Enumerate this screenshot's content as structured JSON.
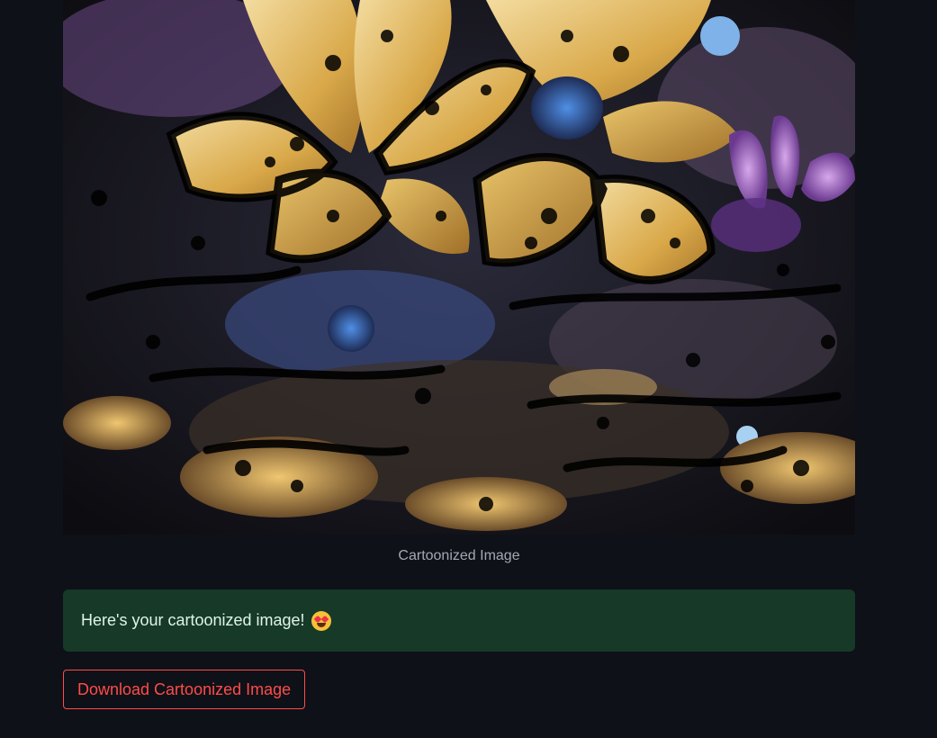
{
  "image": {
    "alt": "Cartoonized flower image",
    "caption": "Cartoonized Image"
  },
  "alert": {
    "message": "Here's your cartoonized image!",
    "emoji_icon": "star-struck-icon"
  },
  "download": {
    "label": "Download Cartoonized Image"
  },
  "colors": {
    "background": "#0e1117",
    "success_bg": "#173928",
    "accent_red": "#ff4b4b"
  }
}
